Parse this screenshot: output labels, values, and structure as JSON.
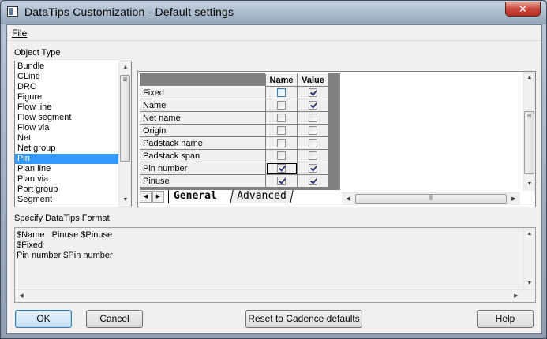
{
  "window": {
    "title": "DataTips Customization -  Default settings",
    "close_glyph": "✕"
  },
  "menu": {
    "file": "File"
  },
  "object_type": {
    "label": "Object Type",
    "items": [
      "Bundle",
      "CLine",
      "DRC",
      "Figure",
      "Flow line",
      "Flow segment",
      "Flow via",
      "Net",
      "Net group",
      "Pin",
      "Plan line",
      "Plan via",
      "Port group",
      "Segment"
    ],
    "selected": "Pin"
  },
  "grid": {
    "col_name": "Name",
    "col_value": "Value",
    "rows": [
      {
        "label": "Fixed",
        "name": false,
        "value": true
      },
      {
        "label": "Name",
        "name": false,
        "value": true
      },
      {
        "label": "Net name",
        "name": false,
        "value": false
      },
      {
        "label": "Origin",
        "name": false,
        "value": false
      },
      {
        "label": "Padstack name",
        "name": false,
        "value": false
      },
      {
        "label": "Padstack span",
        "name": false,
        "value": false
      },
      {
        "label": "Pin number",
        "name": true,
        "value": true
      },
      {
        "label": "Pinuse",
        "name": true,
        "value": true
      }
    ],
    "tabs": {
      "general": "General",
      "advanced": "Advanced"
    }
  },
  "format": {
    "label": "Specify DataTips Format",
    "text": "$Name   Pinuse $Pinuse\n$Fixed\nPin number $Pin number"
  },
  "buttons": {
    "ok": "OK",
    "cancel": "Cancel",
    "reset": "Reset to Cadence defaults",
    "help": "Help"
  },
  "colors": {
    "selection": "#3399ff",
    "close_button": "#c9483a"
  }
}
